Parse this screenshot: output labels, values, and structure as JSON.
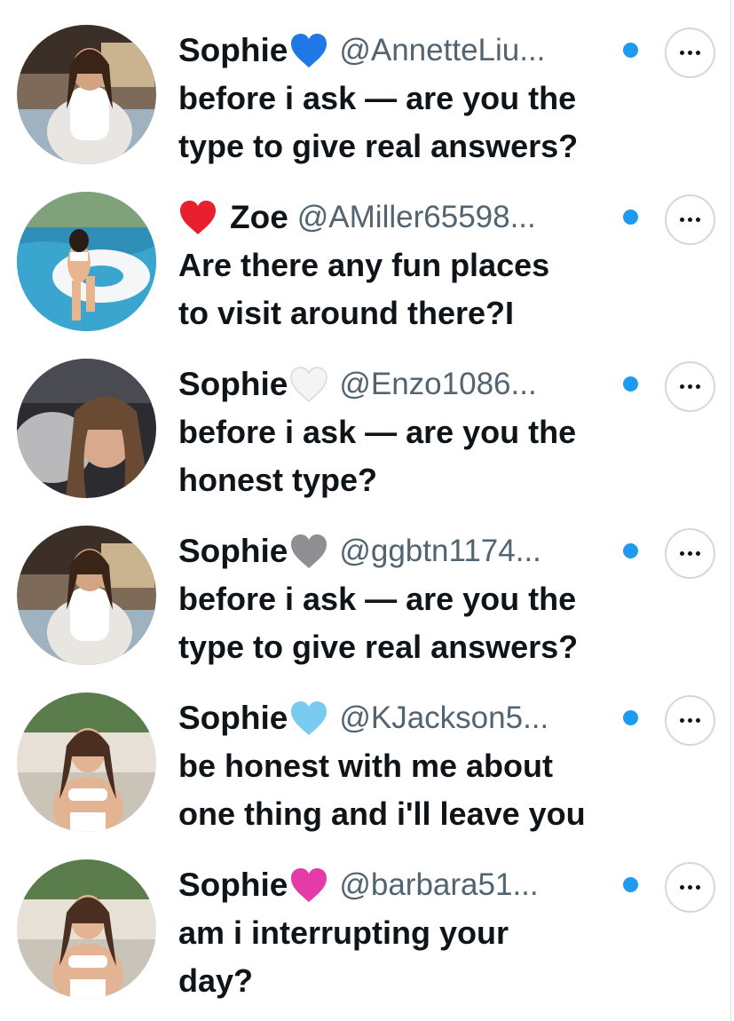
{
  "colors": {
    "text_primary": "#0f1419",
    "text_secondary": "#536471",
    "accent_dot": "#1d9bf0",
    "button_border": "#cfd9de"
  },
  "replies": [
    {
      "name": "Sophie",
      "badge": "blue-heart-icon",
      "handle": "@AnnetteLiu...",
      "text": "before i ask — are you the\ntype to give real answers?"
    },
    {
      "name": "Zoe",
      "badge": "red-heart-icon",
      "handle": "@AMiller65598...",
      "text": "Are there any fun places\nto visit around there?I"
    },
    {
      "name": "Sophie",
      "badge": "white-heart-icon",
      "handle": "@Enzo1086...",
      "text": "before i ask — are you the\nhonest type?"
    },
    {
      "name": "Sophie",
      "badge": "grey-heart-icon",
      "handle": "@ggbtn1174...",
      "text": "before i ask — are you the\ntype to give real answers?"
    },
    {
      "name": "Sophie",
      "badge": "light-blue-heart-icon",
      "handle": "@KJackson5...",
      "text": "be honest with me about\none thing and i'll leave you"
    },
    {
      "name": "Sophie",
      "badge": "pink-heart-icon",
      "handle": "@barbara51...",
      "text": "am i interrupting your\nday?"
    }
  ]
}
